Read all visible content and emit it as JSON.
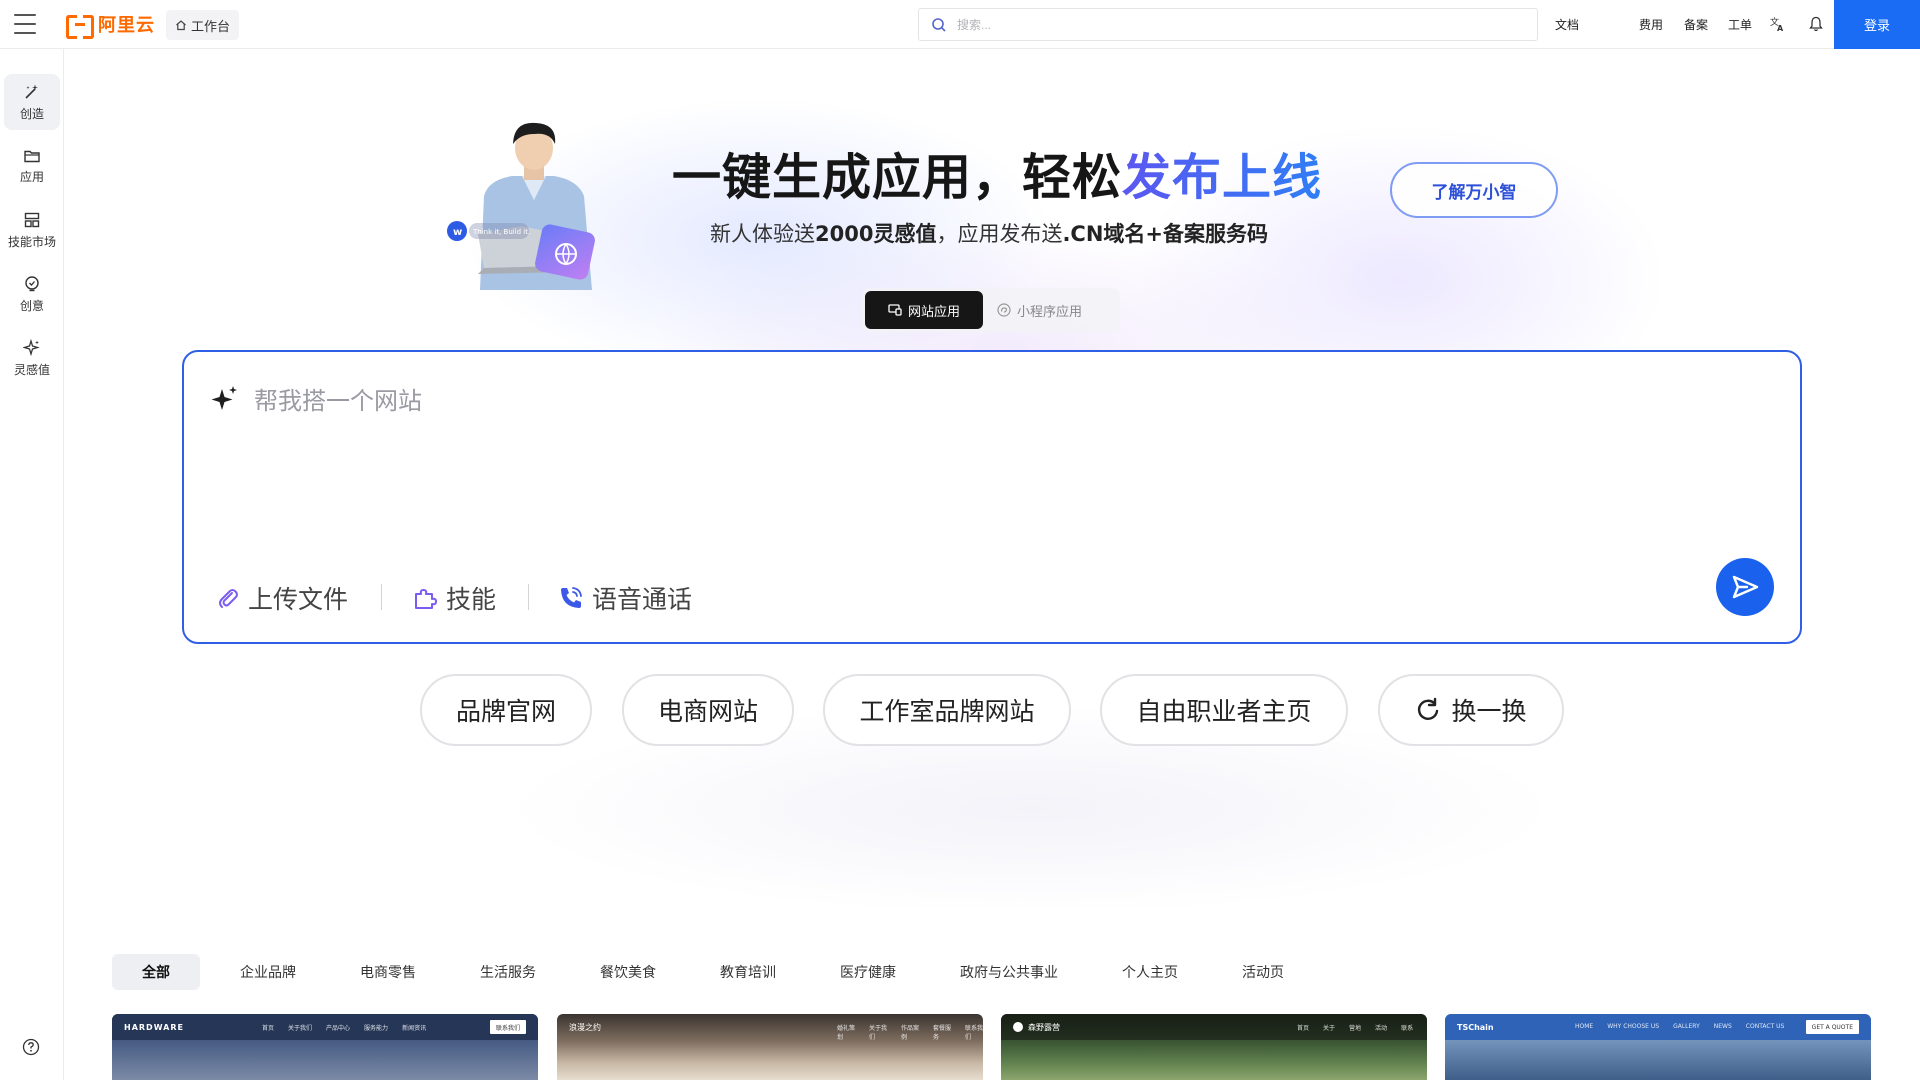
{
  "header": {
    "logo_text": "阿里云",
    "workbench_label": "工作台",
    "search_placeholder": "搜索...",
    "links": {
      "docs": "文档",
      "billing": "费用",
      "icp": "备案",
      "ticket": "工单"
    },
    "login_label": "登录",
    "icons": [
      "menu-icon",
      "home-icon",
      "search-icon",
      "translate-icon",
      "bell-icon"
    ]
  },
  "sidebar": {
    "items": [
      {
        "label": "创造",
        "icon": "magic-wand-icon",
        "active": true
      },
      {
        "label": "应用",
        "icon": "folder-icon"
      },
      {
        "label": "技能市场",
        "icon": "grid-icon"
      },
      {
        "label": "创意",
        "icon": "lightbulb-icon"
      },
      {
        "label": "灵感值",
        "icon": "sparkle-icon"
      }
    ],
    "help_icon": "help-icon"
  },
  "hero": {
    "title_plain": "一键生成应用，轻松",
    "title_highlight": "发布上线",
    "subtitle_parts": [
      "新人体验送",
      "2000灵感值",
      "，应用发布送",
      ".CN域名+备案服务码"
    ],
    "learn_button": "了解万小智",
    "laptop_caption": "Think it, Build it.",
    "accent_color": "#3a64ef"
  },
  "mode_tabs": [
    {
      "label": "网站应用",
      "active": true
    },
    {
      "label": "小程序应用",
      "active": false
    }
  ],
  "prompt": {
    "placeholder": "帮我搭一个网站",
    "tools": [
      {
        "label": "上传文件",
        "icon": "paperclip-icon"
      },
      {
        "label": "技能",
        "icon": "puzzle-icon"
      },
      {
        "label": "语音通话",
        "icon": "phone-call-icon"
      }
    ],
    "send_icon": "send-icon",
    "border_color": "#2f5fe6"
  },
  "suggestions": [
    "品牌官网",
    "电商网站",
    "工作室品牌网站",
    "自由职业者主页"
  ],
  "refresh_label": "换一换",
  "categories": [
    "全部",
    "企业品牌",
    "电商零售",
    "生活服务",
    "餐饮美食",
    "教育培训",
    "医疗健康",
    "政府与公共事业",
    "个人主页",
    "活动页"
  ],
  "templates": [
    {
      "brand": "HARDWARE",
      "nav": [
        "首页",
        "关于我们",
        "产品中心",
        "服务能力",
        "新闻资讯"
      ],
      "cta": "联系我们"
    },
    {
      "brand": "浪漫之约",
      "nav": [
        "婚礼策划",
        "关于我们",
        "作品案例",
        "套餐服务",
        "联系我们"
      ]
    },
    {
      "brand": "森野露营",
      "nav": [
        "首页",
        "关于",
        "营地",
        "活动",
        "联系"
      ]
    },
    {
      "brand": "TSChain",
      "nav": [
        "HOME",
        "WHY CHOOSE US",
        "GALLERY",
        "NEWS",
        "CONTACT US"
      ],
      "cta": "GET A QUOTE"
    }
  ]
}
